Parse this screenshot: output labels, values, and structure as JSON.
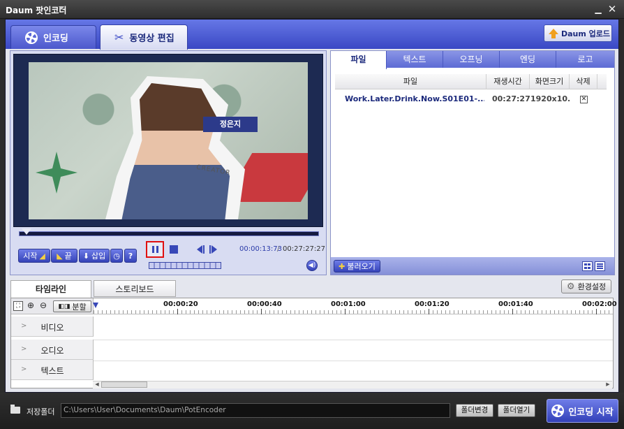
{
  "window": {
    "title": "Daum 팟인코더"
  },
  "main_tabs": [
    {
      "label": "인코딩"
    },
    {
      "label": "동영상 편집"
    }
  ],
  "upload_button": "Daum 업로드",
  "video": {
    "name_tag": "정은지",
    "jacket_text": "CREATOR"
  },
  "controls": {
    "start": "시작",
    "end": "끝",
    "insert": "삽입",
    "help": "?",
    "time_current": "00:00:13:73",
    "time_separator": "/",
    "time_total": "00:27:27:27"
  },
  "right_tabs": [
    "파일",
    "텍스트",
    "오프닝",
    "엔딩",
    "로고"
  ],
  "file_table": {
    "headers": [
      "파일",
      "재생시간",
      "화면크기",
      "삭제"
    ],
    "rows": [
      {
        "file": "Work.Later.Drink.Now.S01E01-...",
        "duration": "00:27:27",
        "size": "1920x10..."
      }
    ]
  },
  "load_button": "불러오기",
  "timeline": {
    "tabs": [
      "타임라인",
      "스토리보드"
    ],
    "settings_button": "환경설정",
    "split_button": "분할",
    "ruler": [
      "00:00:20",
      "00:00:40",
      "00:01:00",
      "00:01:20",
      "00:01:40",
      "00:02:00"
    ],
    "tracks": [
      "비디오",
      "오디오",
      "텍스트"
    ]
  },
  "bottom": {
    "save_folder_label": "저장폴더",
    "path": "C:\\Users\\User\\Documents\\Daum\\PotEncoder",
    "folder_change": "폴더변경",
    "folder_open": "폴더열기",
    "start_encoding": "인코딩 시작"
  },
  "colors": {
    "accent": "#3a48c4",
    "pause_highlight": "#e01010"
  }
}
